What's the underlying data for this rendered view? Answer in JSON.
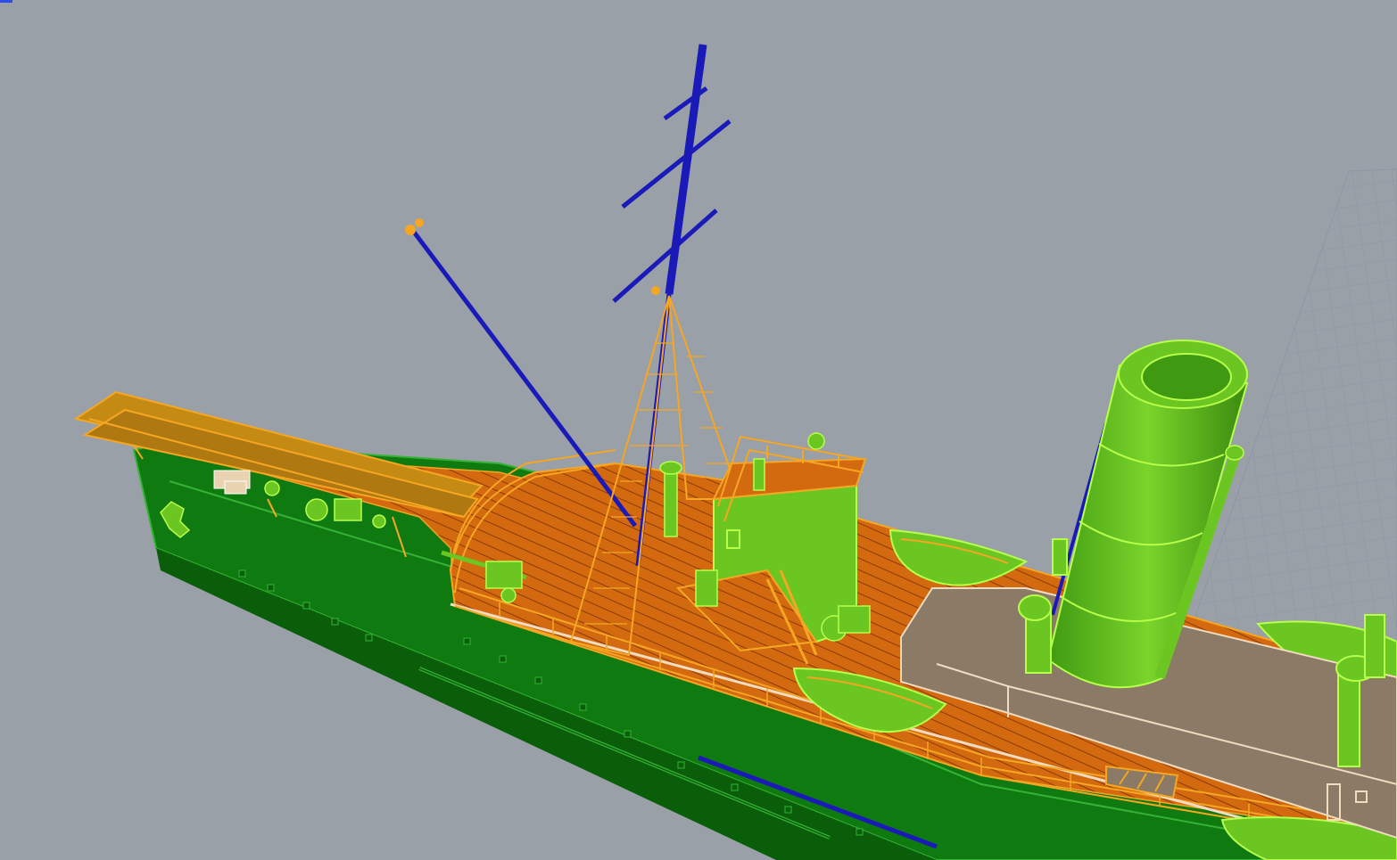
{
  "viewport": {
    "background": "#9aa0a8",
    "grid_color": "#8e96a2",
    "corner_marker_color": "#2a4cf0",
    "render_mode": "shaded-with-edges",
    "model": "ship"
  },
  "palette": {
    "hull": "#0f7a0f",
    "hull_dark": "#0a5e0a",
    "hull_edge": "#36b336",
    "deck": "#d46a10",
    "deck_planks": "#8a3a06",
    "railing": "#f5a623",
    "fittings": "#6cc622",
    "fittings_edge": "#b6ff4a",
    "mast": "#1a1ab8",
    "deckhouse": "#8b7b66",
    "deckhouse_edge": "#f0dcc0"
  },
  "layers": [
    {
      "name": "hull",
      "color": "#0f7a0f"
    },
    {
      "name": "deck",
      "color": "#d46a10"
    },
    {
      "name": "railings",
      "color": "#f5a623"
    },
    {
      "name": "fittings",
      "color": "#6cc622"
    },
    {
      "name": "masts",
      "color": "#1a1ab8"
    },
    {
      "name": "deckhouse",
      "color": "#8b7b66"
    }
  ]
}
